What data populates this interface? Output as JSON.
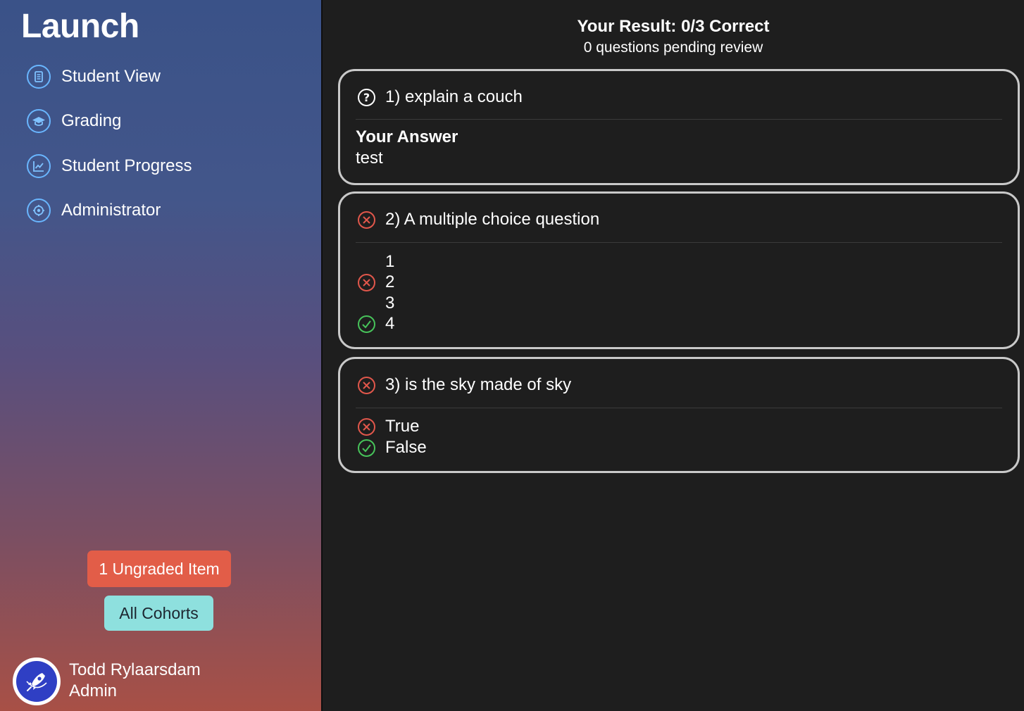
{
  "sidebar": {
    "title": "Launch",
    "items": [
      {
        "label": "Student View",
        "icon": "document-icon"
      },
      {
        "label": "Grading",
        "icon": "graduation-cap-icon"
      },
      {
        "label": "Student Progress",
        "icon": "chart-icon"
      },
      {
        "label": "Administrator",
        "icon": "gear-icon"
      }
    ],
    "ungraded_button": "1 Ungraded Item",
    "cohorts_button": "All Cohorts",
    "user": {
      "name": "Todd Rylaarsdam",
      "role": "Admin"
    }
  },
  "result": {
    "title": "Your Result: 0/3 Correct",
    "subtitle": "0 questions pending review"
  },
  "questions": [
    {
      "text": "1) explain a couch",
      "status": "question-mark-icon",
      "answer_label": "Your Answer",
      "answer": "test"
    },
    {
      "text": "2) A multiple choice question",
      "status": "x-circle-icon",
      "options": [
        {
          "label": "1",
          "mark": "none"
        },
        {
          "label": "2",
          "mark": "x-circle-icon"
        },
        {
          "label": "3",
          "mark": "none"
        },
        {
          "label": "4",
          "mark": "check-circle-icon"
        }
      ]
    },
    {
      "text": "3) is the sky made of sky",
      "status": "x-circle-icon",
      "options": [
        {
          "label": "True",
          "mark": "x-circle-icon"
        },
        {
          "label": "False",
          "mark": "check-circle-icon"
        }
      ]
    }
  ],
  "colors": {
    "accent_blue": "#69b6ff",
    "incorrect_red": "#e1574b",
    "correct_green": "#47c35a",
    "ungraded_button": "#e25d48",
    "cohorts_button": "#8ee0de",
    "panel_background": "#1e1e1e"
  }
}
